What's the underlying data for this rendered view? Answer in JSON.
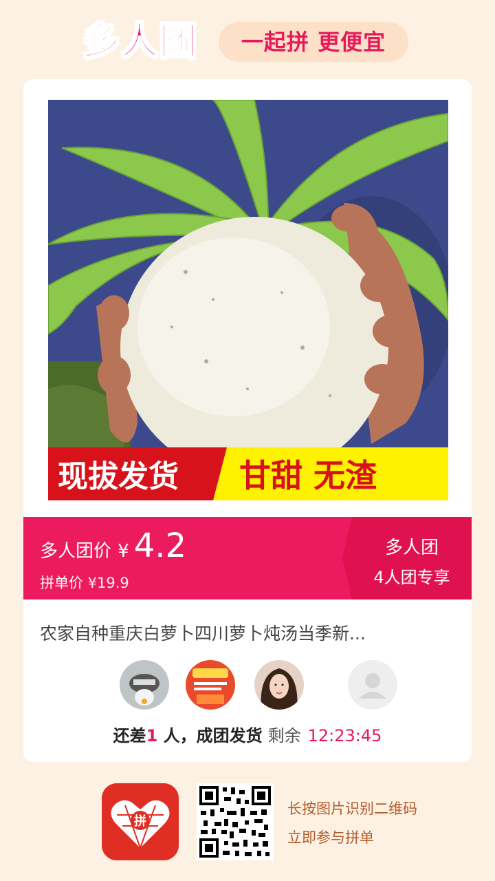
{
  "header": {
    "logo": "多人团",
    "slogan": "一起拼 更便宜"
  },
  "product": {
    "banner_left": "现拔发货",
    "banner_right": "甘甜 无渣",
    "title": "农家自种重庆白萝卜四川萝卜炖汤当季新..."
  },
  "price": {
    "label": "多人团价",
    "yen": "¥",
    "value": "4.2",
    "original": "拼单价 ¥19.9",
    "group_tag": "多人团",
    "group_sub": "4人团专享"
  },
  "status": {
    "prefix": "还差",
    "count": "1",
    "suffix": " 人，成团发货",
    "remain_label": "剩余",
    "timer": "12:23:45"
  },
  "footer": {
    "app_icon_text": "拼",
    "line1": "长按图片识别二维码",
    "line2": "立即参与拼单"
  },
  "colors": {
    "accent": "#ec1a5e",
    "background": "#fdf1e3",
    "footer_text": "#b25b2a"
  }
}
